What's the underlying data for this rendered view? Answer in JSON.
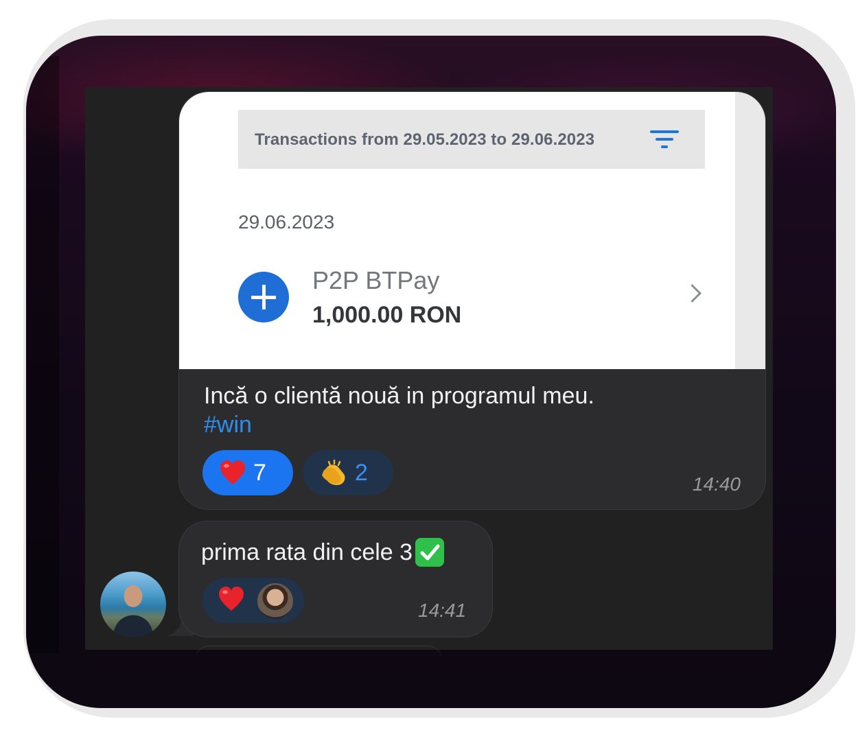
{
  "transaction_screenshot": {
    "filter_text": "Transactions from 29.05.2023 to 29.06.2023",
    "date": "29.06.2023",
    "transaction": {
      "name": "P2P BTPay",
      "amount": "1,000.00 RON",
      "icon": "plus-icon"
    }
  },
  "messages": [
    {
      "text": "Incă o clientă nouă in programul meu.",
      "hashtag": "#win",
      "reactions": [
        {
          "emoji": "heart",
          "count": "7"
        },
        {
          "emoji": "clapping-hands",
          "count": "2"
        }
      ],
      "time": "14:40"
    },
    {
      "text": "prima rata din cele 3",
      "emoji_suffix": "check-mark",
      "reactions": [
        {
          "emoji": "heart"
        }
      ],
      "time": "14:41"
    }
  ],
  "colors": {
    "accent_blue": "#1b74f0",
    "hashtag": "#2e8ff0",
    "bank_blue": "#1e6ed6"
  }
}
